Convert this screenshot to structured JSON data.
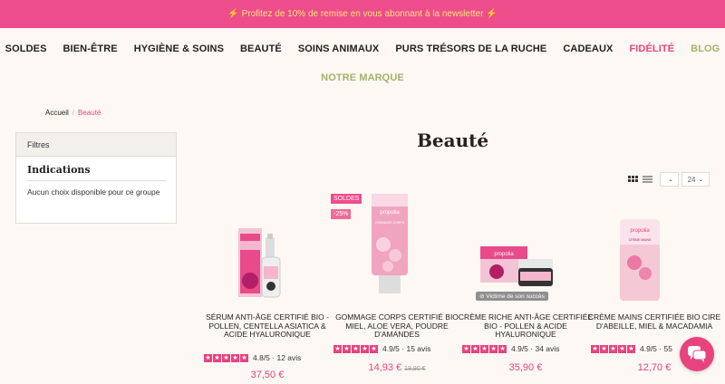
{
  "promo": {
    "text": "Profitez de 10% de remise en vous abonnant à la newsletter",
    "icon": "lightning-icon"
  },
  "nav": {
    "row1": [
      "SOLDES",
      "BIEN-ÊTRE",
      "HYGIÈNE & SOINS",
      "BEAUTÉ",
      "SOINS ANIMAUX",
      "PURS TRÉSORS DE LA RUCHE",
      "CADEAUX",
      "FIDÉLITÉ",
      "BLOG"
    ],
    "row2": [
      "NOTRE MARQUE"
    ],
    "accent_pink": "#e8437f",
    "accent_green": "#a2b468"
  },
  "breadcrumb": {
    "home": "Accueil",
    "separator": "/",
    "current": "Beauté"
  },
  "filters": {
    "header": "Filtres",
    "title": "Indications",
    "text": "Aucun choix disponible pour ce groupe"
  },
  "page_title": "Beauté",
  "toolbar": {
    "per_page": "24"
  },
  "products": [
    {
      "name": "SÉRUM ANTI-ÂGE CERTIFIÉ BIO - POLLEN, CENTELLA ASIATICA & ACIDE HYALURONIQUE",
      "rating": "4.8/5",
      "reviews": "12 avis",
      "price": "37,50 €",
      "old_price": ""
    },
    {
      "name": "GOMMAGE CORPS CERTIFIÉ BIO MIEL, ALOE VERA, POUDRE D'AMANDES",
      "rating": "4.9/5",
      "reviews": "15 avis",
      "price": "14,93 €",
      "old_price": "19,90 €",
      "badges": [
        "SOLDES",
        "-25%"
      ]
    },
    {
      "name": "CRÈME RICHE ANTI-ÂGE CERTIFIÉE BIO - POLLEN & ACIDE HYALURONIQUE",
      "rating": "4.9/5",
      "reviews": "34 avis",
      "price": "35,90 €",
      "old_price": "",
      "tag": "Victime de son succès"
    },
    {
      "name": "CRÈME MAINS CERTIFIÉE BIO CIRE D'ABEILLE, MIEL & MACADAMIA",
      "rating": "4.9/5",
      "reviews": "55",
      "price": "12,70 €",
      "old_price": ""
    }
  ],
  "brand_labels": {
    "logo": "propolia",
    "gommage": "GOMMAGE CORPS",
    "creme_mains": "CRÈME MAINS",
    "creme_riche": "CRÈME RICHE ANTI-ÂGE"
  }
}
